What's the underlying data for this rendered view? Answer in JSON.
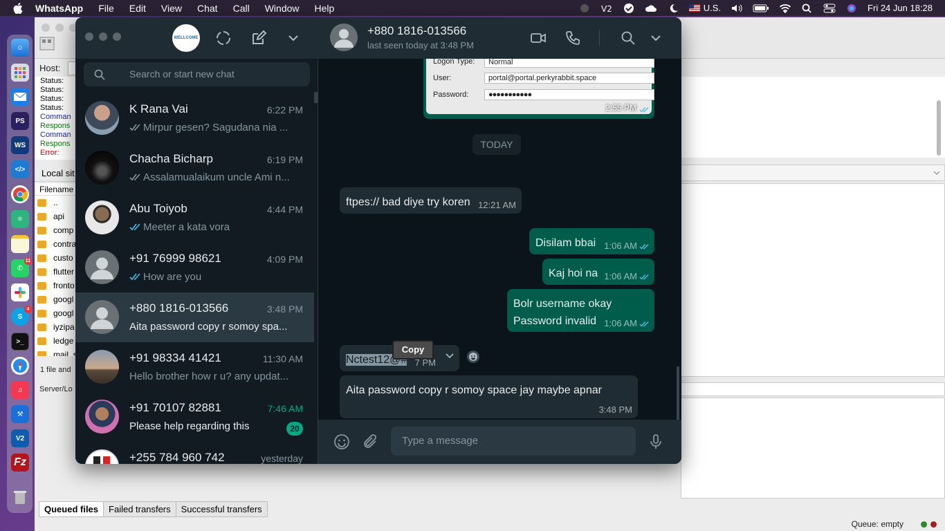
{
  "menubar": {
    "app": "WhatsApp",
    "items": [
      "File",
      "Edit",
      "View",
      "Chat",
      "Call",
      "Window",
      "Help"
    ],
    "input_source": "U.S.",
    "datetime": "Fri 24 Jun  18:28"
  },
  "dock": {
    "badges": {
      "whatsapp": "11",
      "skype": "4"
    }
  },
  "filezilla": {
    "host_label": "Host:",
    "status_lines": [
      {
        "text": "Status:",
        "kind": "s"
      },
      {
        "text": "Status:",
        "kind": "s"
      },
      {
        "text": "Status:",
        "kind": "s"
      },
      {
        "text": "Status:",
        "kind": "s"
      },
      {
        "text": "Comman",
        "kind": "b"
      },
      {
        "text": "Respons",
        "kind": "g"
      },
      {
        "text": "Comman",
        "kind": "b"
      },
      {
        "text": "Respons",
        "kind": "g"
      },
      {
        "text": "Error:",
        "kind": "r"
      }
    ],
    "local_site_label": "Local sit",
    "filename_header": "Filename",
    "files": [
      "..",
      "api",
      "comp",
      "contra",
      "custo",
      "flutter",
      "fronto",
      "googl",
      "googl",
      "iyzipa",
      "ledge",
      "mail_s"
    ],
    "file_count": "1 file and",
    "server_local": "Server/Lo",
    "tabs": [
      "Queued files",
      "Failed transfers",
      "Successful transfers"
    ],
    "queue_status": "Queue: empty"
  },
  "whatsapp": {
    "logo_text": "WELLCOME",
    "search_placeholder": "Search or start new chat",
    "chats": [
      {
        "name": "K Rana Vai",
        "time": "6:22 PM",
        "preview": "Mirpur gesen? Sagudana nia ...",
        "tick": "grey",
        "avatar": "photo1"
      },
      {
        "name": "Chacha Bicharp",
        "time": "6:19 PM",
        "preview": "Assalamualaikum uncle Ami n...",
        "tick": "grey",
        "avatar": "photo2"
      },
      {
        "name": "Abu Toiyob",
        "time": "4:44 PM",
        "preview": "Meeter a kata vora",
        "tick": "blue",
        "avatar": "photo3"
      },
      {
        "name": "+91 76999 98621",
        "time": "4:09 PM",
        "preview": "How are you",
        "tick": "blue",
        "avatar": "default"
      },
      {
        "name": "+880 1816-013566",
        "time": "3:48 PM",
        "preview": "Aita password copy r somoy spa...",
        "tick": "none",
        "avatar": "default",
        "active": true
      },
      {
        "name": "+91 98334 41421",
        "time": "11:30 AM",
        "preview": "Hello brother how r u? any updat...",
        "tick": "none",
        "avatar": "photo4"
      },
      {
        "name": "+91 70107 82881",
        "time": "7:46 AM",
        "preview": "Please help regarding this",
        "tick": "none",
        "avatar": "photo5",
        "unread": "20"
      },
      {
        "name": "+255 784 960 742",
        "time": "yesterday",
        "preview": "",
        "tick": "none",
        "avatar": "photo6"
      }
    ],
    "conversation": {
      "name": "+880 1816-013566",
      "status": "last seen today at 3:48 PM",
      "image_message": {
        "logon_type_label": "Logon Type:",
        "logon_type_value": "Normal",
        "user_label": "User:",
        "user_value": "portal@portal.perkyrabbit.space",
        "password_label": "Password:",
        "password_value": "●●●●●●●●●●●",
        "time": "2:55 PM"
      },
      "day_chip": "TODAY",
      "messages": [
        {
          "dir": "in",
          "text": "ftpes:// bad diye try koren",
          "time": "12:21 AM"
        },
        {
          "dir": "out",
          "text": "Disilam bbai",
          "time": "1:06 AM"
        },
        {
          "dir": "out",
          "text": "Kaj hoi na",
          "time": "1:06 AM"
        },
        {
          "dir": "out",
          "text": "Bolr username okay\nPassword invalid",
          "time": "1:06 AM"
        },
        {
          "dir": "in",
          "text": "Nctest12@#",
          "time": "7 PM"
        },
        {
          "dir": "in",
          "text": "Aita password copy r somoy space jay maybe apnar",
          "time": "3:48 PM"
        }
      ],
      "copy_popup": "Copy",
      "composer_placeholder": "Type a message"
    }
  },
  "colors": {
    "wa_bg": "#111b21",
    "wa_panel": "#202c33",
    "outgoing": "#005c4b",
    "accent_green": "#00a884",
    "read_tick": "#53bdeb"
  }
}
